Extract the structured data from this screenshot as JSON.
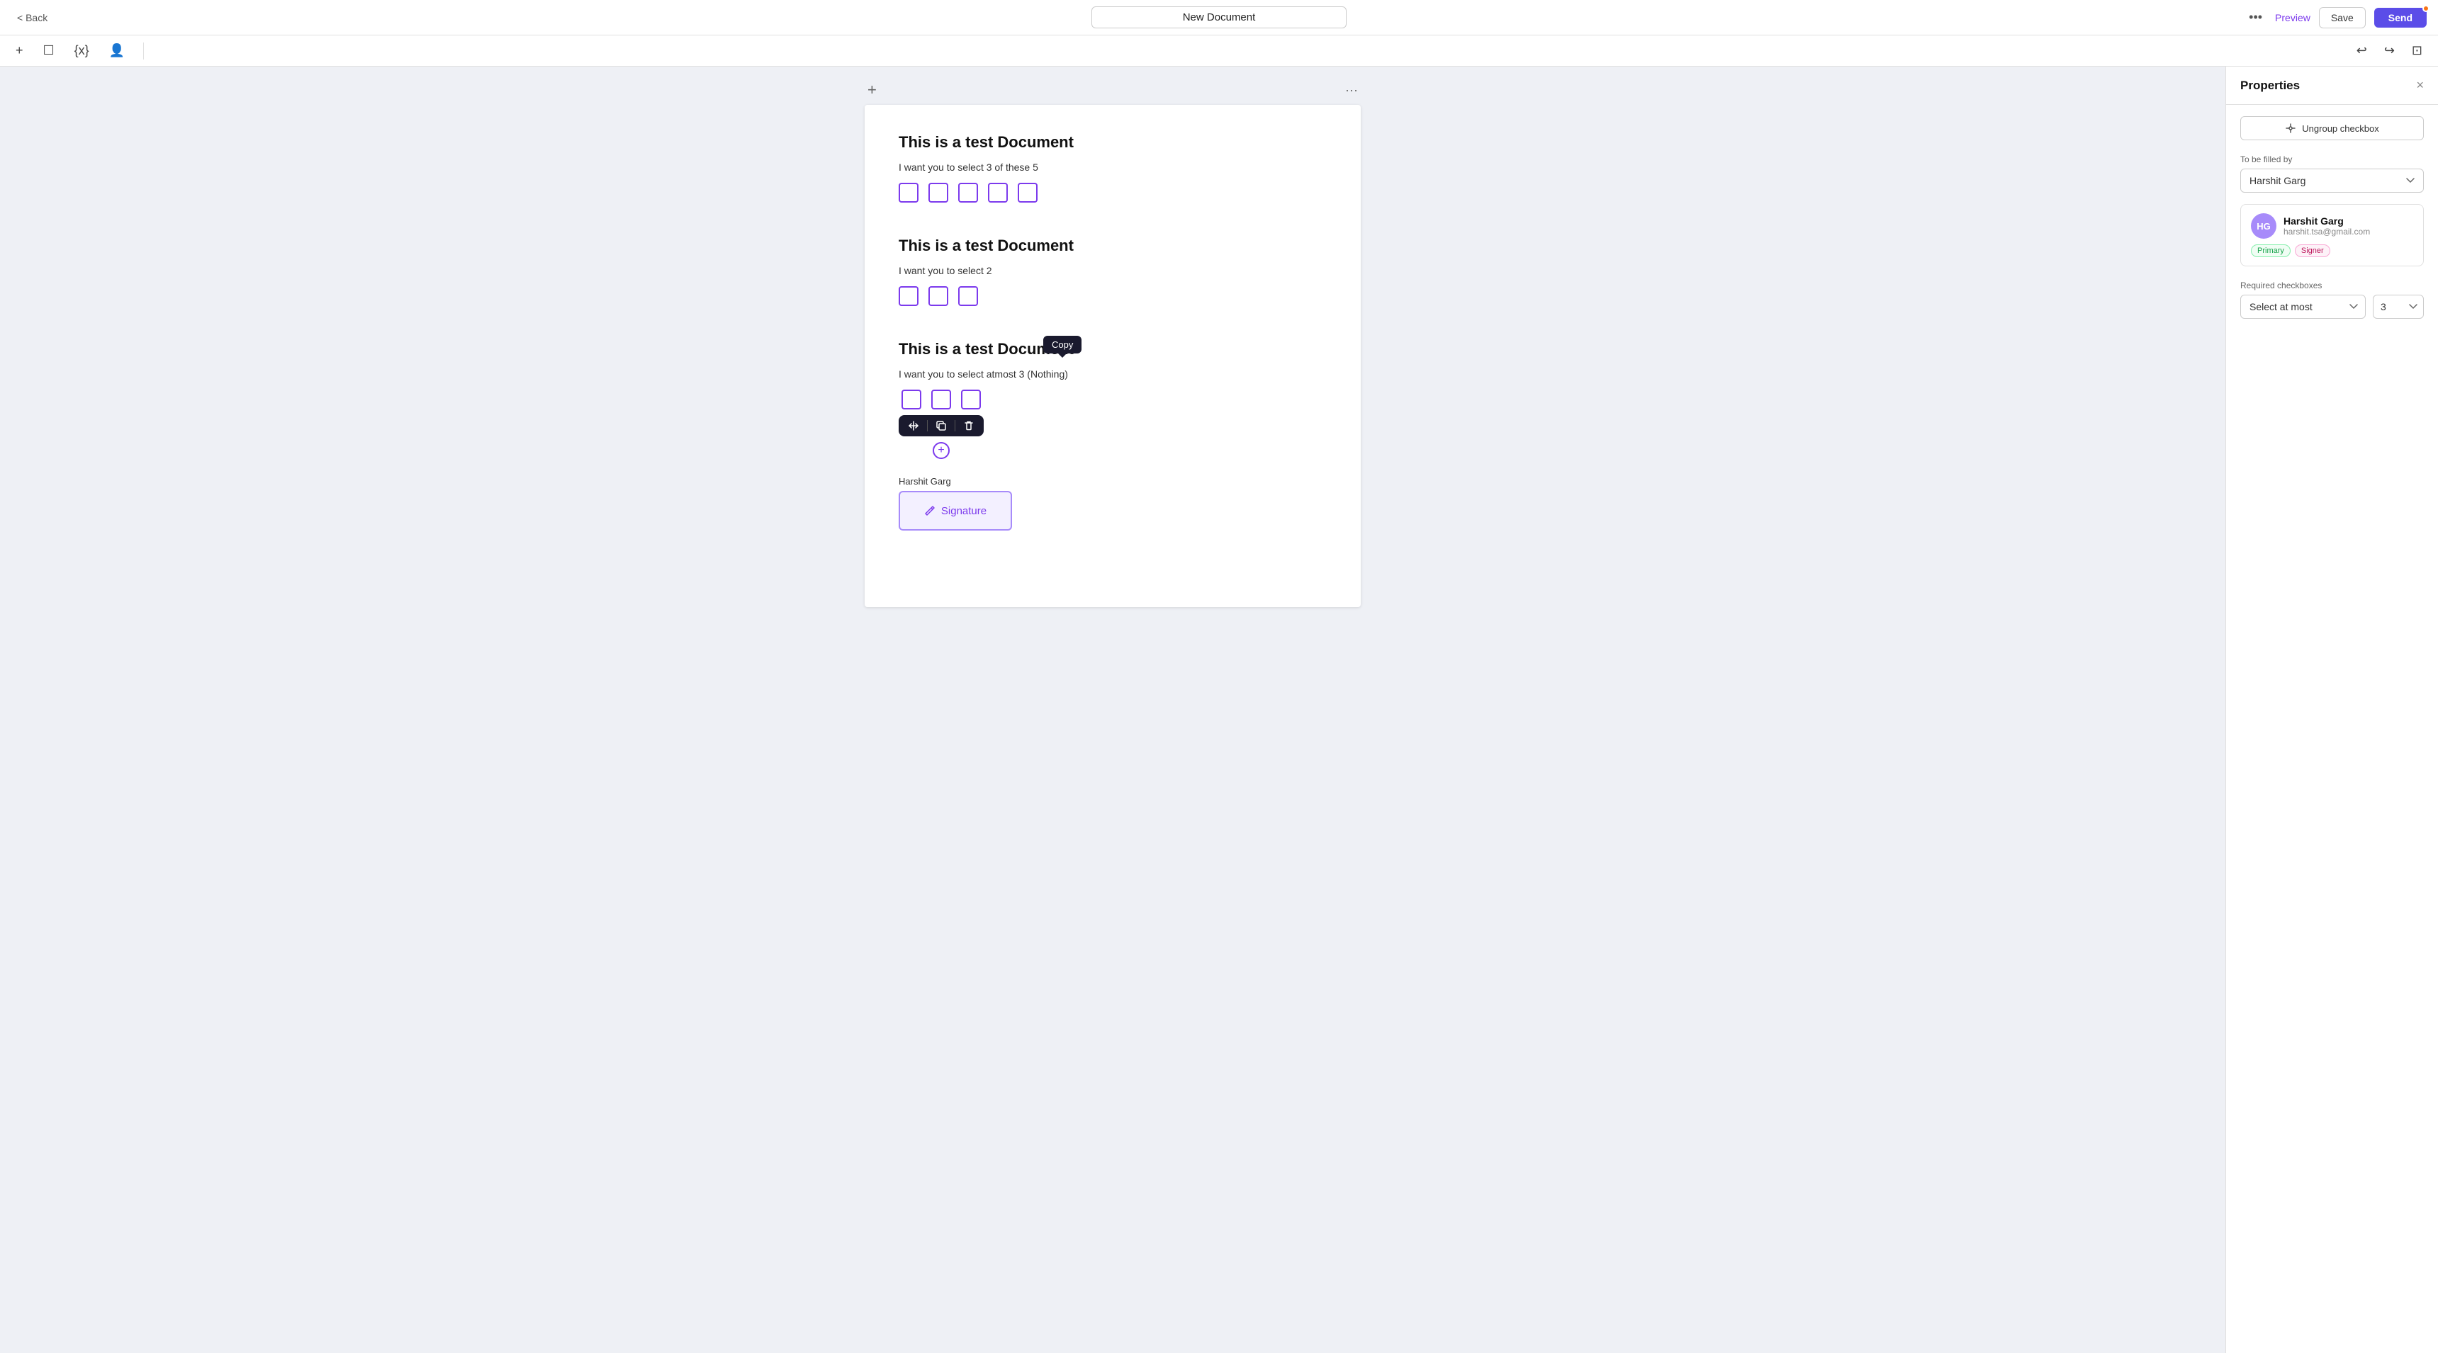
{
  "header": {
    "back_label": "< Back",
    "title": "New Document",
    "more_icon": "•••",
    "preview_label": "Preview",
    "save_label": "Save",
    "send_label": "Send"
  },
  "toolbar": {
    "add_icon": "+",
    "page_icon": "☐",
    "variable_icon": "{x}",
    "person_icon": "👤",
    "undo_icon": "↩",
    "redo_icon": "↪",
    "crop_icon": "⊡"
  },
  "canvas": {
    "add_section_icon": "+",
    "more_icon": "···",
    "sections": [
      {
        "title": "This is a test Document",
        "text": "I want you to select 3 of these 5",
        "checkboxes": 5
      },
      {
        "title": "This is a test Document",
        "text": "I want you to select 2",
        "checkboxes": 3
      },
      {
        "title": "This is a test Document",
        "text": "I want you to select atmost 3 (Nothing)",
        "checkboxes": 3,
        "has_tooltip": true
      }
    ],
    "signature_label": "Harshit Garg",
    "signature_text": "Signature"
  },
  "tooltip": {
    "label": "Copy"
  },
  "mini_toolbar": {
    "resize_icon": "<>",
    "copy_icon": "⧉",
    "delete_icon": "🗑"
  },
  "properties": {
    "title": "Properties",
    "close_icon": "×",
    "ungroup_label": "Ungroup checkbox",
    "ungroup_icon": "<>",
    "to_be_filled_label": "To be filled by",
    "assignee": "Harshit Garg",
    "signer": {
      "initials": "HG",
      "name": "Harshit Garg",
      "email": "harshit.tsa@gmail.com",
      "badge_primary": "Primary",
      "badge_signer": "Signer"
    },
    "required_checkboxes_label": "Required checkboxes",
    "required_type": "Select at most",
    "required_number": "3"
  }
}
